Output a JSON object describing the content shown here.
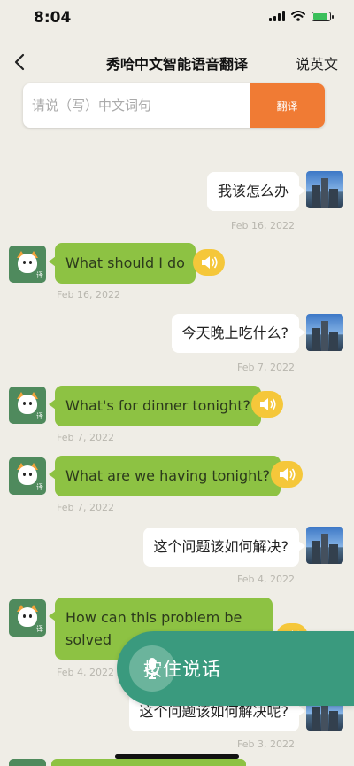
{
  "status_bar": {
    "time": "8:04"
  },
  "nav": {
    "title": "秀哈中文智能语音翻译",
    "right_label": "说英文"
  },
  "search": {
    "placeholder": "请说（写）中文词句",
    "button_label": "翻译"
  },
  "messages": [
    {
      "sender": "user",
      "text": "我该怎么办",
      "date": "Feb 16, 2022"
    },
    {
      "sender": "bot",
      "text": "What should I do",
      "date": "Feb 16, 2022"
    },
    {
      "sender": "user",
      "text": "今天晚上吃什么?",
      "date": "Feb 7, 2022"
    },
    {
      "sender": "bot",
      "text": "What's for dinner tonight?",
      "date": "Feb 7, 2022"
    },
    {
      "sender": "bot",
      "text": "What are we having tonight?",
      "date": "Feb 7, 2022"
    },
    {
      "sender": "user",
      "text": "这个问题该如何解决?",
      "date": "Feb 4, 2022"
    },
    {
      "sender": "bot",
      "text": "How can this problem be solved",
      "date": "Feb 4, 2022"
    },
    {
      "sender": "user",
      "text": "这个问题该如何解决呢?",
      "date": "Feb 3, 2022"
    }
  ],
  "bot_avatar_tag": "译",
  "voice_button": {
    "label": "按住说话"
  },
  "colors": {
    "background": "#efede6",
    "accent_orange": "#f07b34",
    "bot_bubble": "#8dc243",
    "voice_green": "#3a9a7e",
    "speaker_yellow": "#f5c73a"
  }
}
